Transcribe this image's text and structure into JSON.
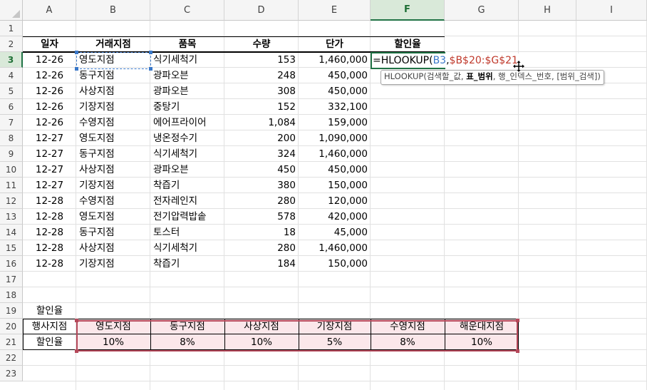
{
  "columns": [
    "A",
    "B",
    "C",
    "D",
    "E",
    "F",
    "G",
    "H",
    "I"
  ],
  "rows": [
    "1",
    "2",
    "3",
    "4",
    "5",
    "6",
    "7",
    "8",
    "9",
    "10",
    "11",
    "12",
    "13",
    "14",
    "15",
    "16",
    "17",
    "18",
    "19",
    "20",
    "21",
    "22",
    "23"
  ],
  "headers": {
    "date": "일자",
    "branch": "거래지점",
    "item": "품목",
    "qty": "수량",
    "price": "단가",
    "discount": "할인율"
  },
  "records": [
    {
      "date": "12-26",
      "branch": "영도지점",
      "item": "식기세척기",
      "qty": "153",
      "price": "1,460,000"
    },
    {
      "date": "12-26",
      "branch": "동구지점",
      "item": "광파오븐",
      "qty": "248",
      "price": "450,000"
    },
    {
      "date": "12-26",
      "branch": "사상지점",
      "item": "광파오븐",
      "qty": "308",
      "price": "450,000"
    },
    {
      "date": "12-26",
      "branch": "기장지점",
      "item": "중탕기",
      "qty": "152",
      "price": "332,100"
    },
    {
      "date": "12-26",
      "branch": "수영지점",
      "item": "에어프라이어",
      "qty": "1,084",
      "price": "159,000"
    },
    {
      "date": "12-27",
      "branch": "영도지점",
      "item": "냉온정수기",
      "qty": "200",
      "price": "1,090,000"
    },
    {
      "date": "12-27",
      "branch": "동구지점",
      "item": "식기세척기",
      "qty": "324",
      "price": "1,460,000"
    },
    {
      "date": "12-27",
      "branch": "사상지점",
      "item": "광파오븐",
      "qty": "450",
      "price": "450,000"
    },
    {
      "date": "12-27",
      "branch": "기장지점",
      "item": "착즙기",
      "qty": "380",
      "price": "150,000"
    },
    {
      "date": "12-28",
      "branch": "수영지점",
      "item": "전자레인지",
      "qty": "280",
      "price": "120,000"
    },
    {
      "date": "12-28",
      "branch": "영도지점",
      "item": "전기압력밥솥",
      "qty": "578",
      "price": "420,000"
    },
    {
      "date": "12-28",
      "branch": "동구지점",
      "item": "토스터",
      "qty": "18",
      "price": "45,000"
    },
    {
      "date": "12-28",
      "branch": "사상지점",
      "item": "식기세척기",
      "qty": "280",
      "price": "1,460,000"
    },
    {
      "date": "12-28",
      "branch": "기장지점",
      "item": "착즙기",
      "qty": "184",
      "price": "150,000"
    }
  ],
  "formula": {
    "prefix": "=HLOOKUP(",
    "ref1": "B3",
    "sep": ",",
    "ref2": "$B$20:$G$21"
  },
  "tooltip": {
    "fn": "HLOOKUP(",
    "arg1": "검색할_값, ",
    "arg2": "표_범위",
    "arg3": ", 행_인덱스_번호, [범위_검색])"
  },
  "lookup_title": "할인율",
  "lookup_row_label": "행사지점",
  "lookup_value_label": "할인율",
  "lookup_branches": [
    "영도지점",
    "동구지점",
    "사상지점",
    "기장지점",
    "수영지점",
    "해운대지점"
  ],
  "lookup_rates": [
    "10%",
    "8%",
    "10%",
    "5%",
    "8%",
    "10%"
  ],
  "colors": {
    "accent": "#217346",
    "ref_blue": "#3a78c9",
    "ref_red": "#b5485a",
    "range_fill": "#fbe7ea"
  }
}
